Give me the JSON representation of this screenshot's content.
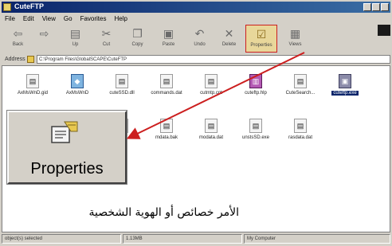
{
  "window": {
    "title": "CuteFTP"
  },
  "menu": [
    {
      "label": "File"
    },
    {
      "label": "Edit"
    },
    {
      "label": "View"
    },
    {
      "label": "Go"
    },
    {
      "label": "Favorites"
    },
    {
      "label": "Help"
    }
  ],
  "toolbar": {
    "buttons": [
      {
        "label": "Back",
        "icon": "back-arrow-icon",
        "glyph": "⇦"
      },
      {
        "label": "",
        "icon": "forward-arrow-icon",
        "glyph": "⇨"
      },
      {
        "label": "Up",
        "icon": "up-folder-icon",
        "glyph": "▤"
      },
      {
        "label": "Cut",
        "icon": "scissors-icon",
        "glyph": "✂"
      },
      {
        "label": "Copy",
        "icon": "copy-icon",
        "glyph": "❐"
      },
      {
        "label": "Paste",
        "icon": "paste-icon",
        "glyph": "▣"
      },
      {
        "label": "Undo",
        "icon": "undo-icon",
        "glyph": "↶"
      },
      {
        "label": "Delete",
        "icon": "delete-icon",
        "glyph": "✕"
      },
      {
        "label": "Properties",
        "icon": "properties-icon",
        "glyph": "☑"
      },
      {
        "label": "Views",
        "icon": "views-icon",
        "glyph": "▦"
      }
    ]
  },
  "address": {
    "label": "Address",
    "value": "C:\\Program Files\\GlobalSCAPE\\CuteFTP"
  },
  "files": [
    {
      "name": "AxMsWnD.gid",
      "kind": "doc"
    },
    {
      "name": "AxMsWnD",
      "kind": "blue"
    },
    {
      "name": "cuteSSD.dll",
      "kind": "doc"
    },
    {
      "name": "commands.dat",
      "kind": "doc"
    },
    {
      "name": "cutmtp.cnt",
      "kind": "doc"
    },
    {
      "name": "cuteftp.hlp",
      "kind": "purple"
    },
    {
      "name": "CuteSearch...",
      "kind": "doc"
    },
    {
      "name": "cuteftp.exe",
      "kind": "pc"
    },
    {
      "name": "",
      "kind": "doc"
    },
    {
      "name": "mdata.bak",
      "kind": "doc"
    },
    {
      "name": "modata.dat",
      "kind": "doc"
    },
    {
      "name": "unstsSD.exe",
      "kind": "doc"
    },
    {
      "name": "rasdata.dat",
      "kind": "doc"
    }
  ],
  "callout": {
    "label": "Properties",
    "icon": "properties-icon"
  },
  "caption": "الأمر خصائص أو الهوية الشخصية",
  "status": [
    {
      "text": "object(s) selected"
    },
    {
      "text": "1.13MB"
    },
    {
      "text": "My Computer"
    }
  ],
  "colors": {
    "highlight": "#cc1f1f",
    "titlebar": "#0a246a",
    "selection": "#0a246a"
  }
}
